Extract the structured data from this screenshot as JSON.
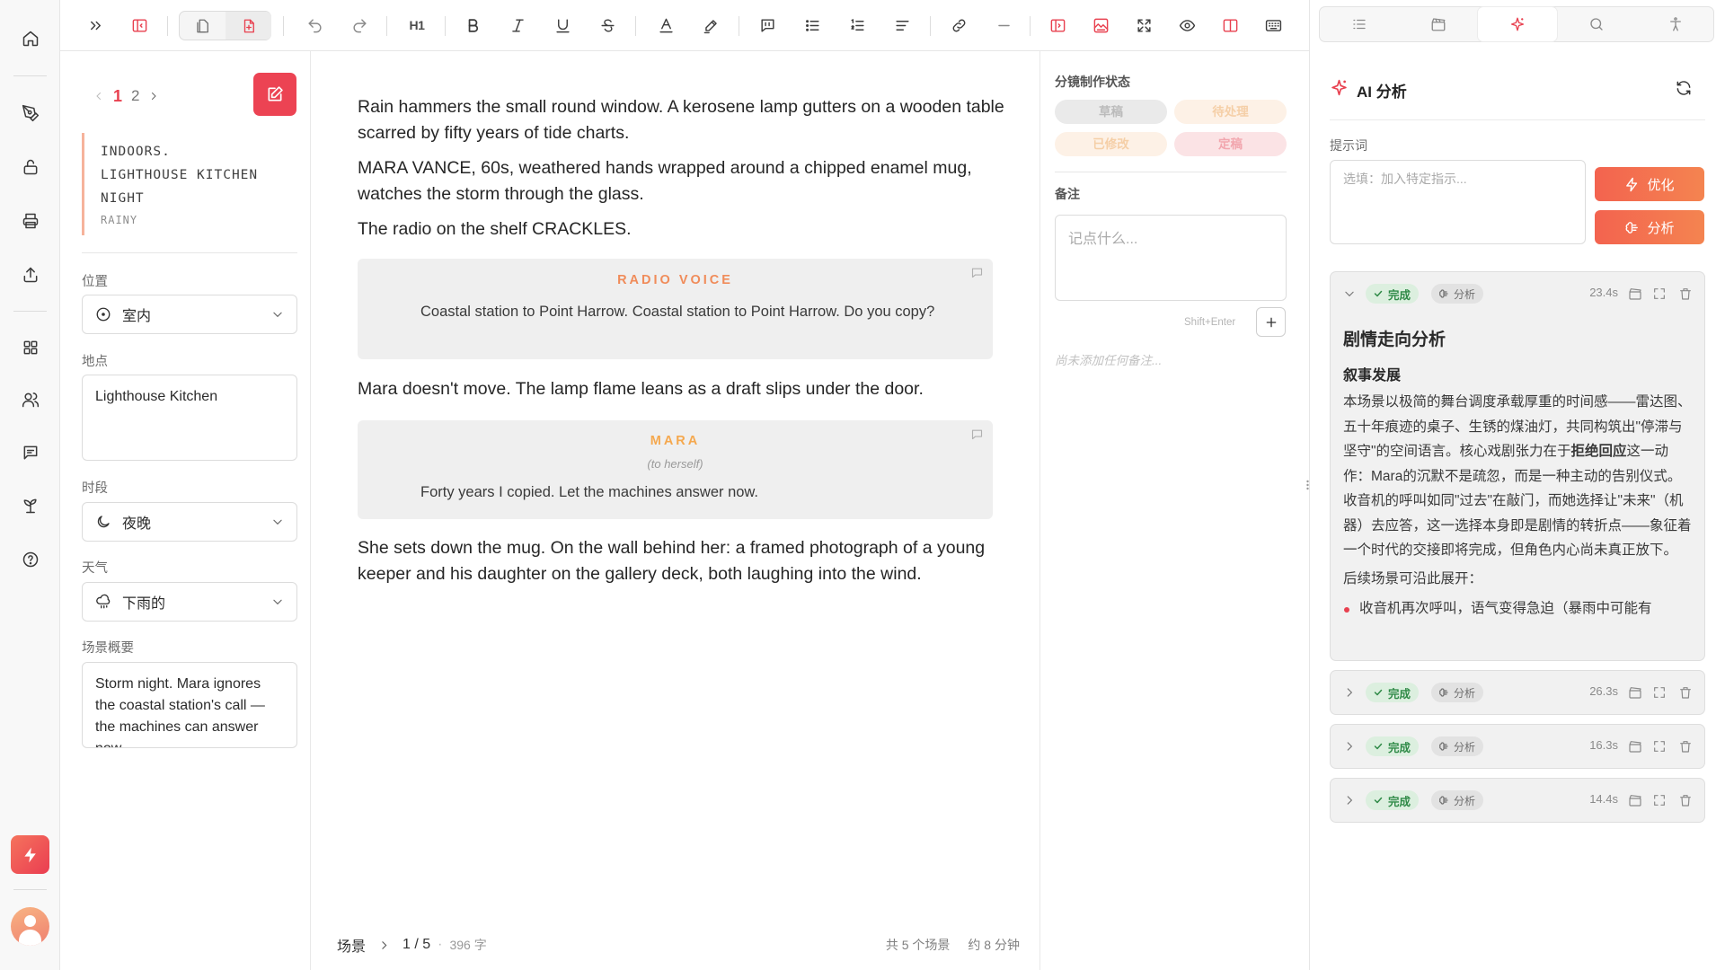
{
  "icons": {
    "rail": [
      "home-icon",
      "pen-nib-icon",
      "lock-icon",
      "printer-icon",
      "share-icon",
      "grid-icon",
      "users-icon",
      "message-icon",
      "sprout-icon",
      "help-icon",
      "bolt-icon",
      "avatar"
    ],
    "toolbar": [
      "chevrons-right-icon",
      "sidebar-toggle-icon",
      "split-view-icon",
      "script-mode-icon",
      "undo-icon",
      "redo-icon",
      "heading-icon",
      "bold-icon",
      "italic-icon",
      "underline-icon",
      "strikethrough-icon",
      "text-color-icon",
      "highlight-icon",
      "comment-icon",
      "bullet-list-icon",
      "numbered-list-icon",
      "align-icon",
      "link-icon",
      "divider-icon",
      "panel-left-icon",
      "image-icon",
      "fullscreen-icon",
      "preview-icon",
      "split-panel-icon",
      "keyboard-icon"
    ]
  },
  "accent_color": "#e8404f",
  "toolbar": {
    "heading_label": "H1"
  },
  "scene_panel": {
    "pager": {
      "current": "1",
      "other": "2"
    },
    "slug": {
      "line1": "INDOORS.",
      "line2": "LIGHTHOUSE KITCHEN",
      "line3": "NIGHT",
      "weather": "RAINY"
    },
    "position_label": "位置",
    "position_value": "室内",
    "location_label": "地点",
    "location_value": "Lighthouse Kitchen",
    "time_label": "时段",
    "time_value": "夜晚",
    "weather_label": "天气",
    "weather_value": "下雨的",
    "summary_label": "场景概要",
    "summary_value": "Storm night. Mara ignores the coastal station's call — the machines can answer now."
  },
  "script": {
    "action1": "Rain hammers the small round window. A kerosene lamp gutters on a wooden table scarred by fifty years of tide charts.",
    "action2": "MARA VANCE, 60s, weathered hands wrapped around a chipped enamel mug, watches the storm through the glass.",
    "action3": "The radio on the shelf CRACKLES.",
    "dialog1": {
      "character": "RADIO VOICE",
      "line": "Coastal station to Point Harrow. Coastal station to Point Harrow. Do you copy?",
      "color": "#f08c5a"
    },
    "action4": "Mara doesn't move. The lamp flame leans as a draft slips under the door.",
    "dialog2": {
      "character": "MARA",
      "parenthetical": "(to herself)",
      "line": "Forty years I copied. Let the machines answer now.",
      "color": "#f5a84e"
    },
    "action5": "She sets down the mug. On the wall behind her: a framed photograph of a young keeper and his daughter on the gallery deck, both laughing into the wind."
  },
  "status_bar": {
    "scene_label": "场景",
    "position": "1 / 5",
    "word_count": "396 字",
    "total_scenes": "共 5 个场景",
    "duration": "约 8 分钟"
  },
  "notes": {
    "status_title": "分镜制作状态",
    "status_pills": [
      "草稿",
      "待处理",
      "已修改",
      "定稿"
    ],
    "notes_title": "备注",
    "placeholder": "记点什么...",
    "shortcut_hint": "Shift+Enter",
    "empty_text": "尚未添加任何备注..."
  },
  "ai_panel": {
    "title": "AI 分析",
    "prompt_label": "提示词",
    "prompt_placeholder": "选填：加入特定指示...",
    "optimize_label": "优化",
    "analyze_label": "分析",
    "cards": [
      {
        "status": "完成",
        "type": "分析",
        "time": "23.4s",
        "expanded": true,
        "heading": "剧情走向分析",
        "subheading": "叙事发展",
        "para1_pre": "本场景以极简的舞台调度承载厚重的时间感——雷达图、五十年痕迹的桌子、生锈的煤油灯，共同构筑出\"停滞与坚守\"的空间语言。核心戏剧张力在于",
        "para1_bold": "拒绝回应",
        "para1_post": "这一动作：Mara的沉默不是疏忽，而是一种主动的告别仪式。收音机的呼叫如同\"过去\"在敲门，而她选择让\"未来\"（机器）去应答，这一选择本身即是剧情的转折点——象征着一个时代的交接即将完成，但角色内心尚未真正放下。",
        "para2": "后续场景可沿此展开：",
        "bullet1": "收音机再次呼叫，语气变得急迫（暴雨中可能有"
      },
      {
        "status": "完成",
        "type": "分析",
        "time": "26.3s",
        "expanded": false
      },
      {
        "status": "完成",
        "type": "分析",
        "time": "16.3s",
        "expanded": false
      },
      {
        "status": "完成",
        "type": "分析",
        "time": "14.4s",
        "expanded": false
      }
    ]
  }
}
